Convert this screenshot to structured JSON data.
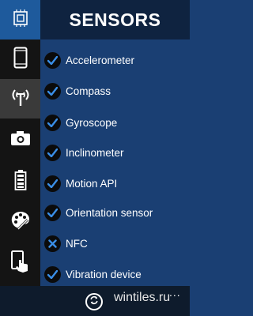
{
  "header": {
    "title": "SENSORS"
  },
  "sidebar": {
    "items": [
      {
        "icon": "chip-icon",
        "active": false
      },
      {
        "icon": "phone-icon",
        "active": false
      },
      {
        "icon": "antenna-icon",
        "active": true
      },
      {
        "icon": "camera-icon",
        "active": false
      },
      {
        "icon": "battery-icon",
        "active": false
      },
      {
        "icon": "palette-icon",
        "active": false
      },
      {
        "icon": "touch-phone-icon",
        "active": false
      }
    ]
  },
  "sensors": [
    {
      "label": "Accelerometer",
      "status": "check"
    },
    {
      "label": "Compass",
      "status": "check"
    },
    {
      "label": "Gyroscope",
      "status": "check"
    },
    {
      "label": "Inclinometer",
      "status": "check"
    },
    {
      "label": "Motion API",
      "status": "check"
    },
    {
      "label": "Orientation sensor",
      "status": "check"
    },
    {
      "label": "NFC",
      "status": "cross"
    },
    {
      "label": "Vibration device",
      "status": "check"
    }
  ],
  "appbar": {
    "watermark": "wintiles.ru",
    "more": "..."
  },
  "colors": {
    "background": "#1a3f73",
    "accent": "#1e5a9c",
    "sidebar": "#141414"
  }
}
